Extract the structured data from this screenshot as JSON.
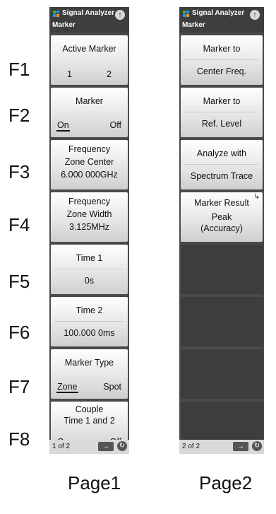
{
  "function_keys": [
    "F1",
    "F2",
    "F3",
    "F4",
    "F5",
    "F6",
    "F7",
    "F8"
  ],
  "page1": {
    "header": {
      "app_title": "Signal Analyzer",
      "menu_title": "Marker",
      "up_icon": "up-arrow-icon"
    },
    "keys": [
      {
        "title": "Active Marker",
        "options": [
          "1",
          "2"
        ],
        "selected": "1"
      },
      {
        "title": "Marker",
        "options": [
          "On",
          "Off"
        ],
        "selected": "On"
      },
      {
        "title_lines": [
          "Frequency",
          "Zone Center",
          "6.000 000GHz"
        ]
      },
      {
        "title_lines": [
          "Frequency",
          "Zone Width",
          "3.125MHz"
        ]
      },
      {
        "title": "Time 1",
        "value": "0s"
      },
      {
        "title": "Time 2",
        "value": "100.000 0ms"
      },
      {
        "title": "Marker Type",
        "options": [
          "Zone",
          "Spot"
        ],
        "selected": "Zone"
      },
      {
        "title_lines": [
          "Couple",
          "Time 1 and 2"
        ],
        "options": [
          "On",
          "Off"
        ],
        "selected": "Off"
      }
    ],
    "footer": {
      "page": "1 of 2",
      "next_icon": "right-arrow-icon",
      "rotate_icon": "rotate-icon"
    },
    "label": "Page1"
  },
  "page2": {
    "header": {
      "app_title": "Signal Analyzer",
      "menu_title": "Marker",
      "up_icon": "up-arrow-icon"
    },
    "keys": [
      {
        "title": "Marker to",
        "value": "Center Freq."
      },
      {
        "title": "Marker to",
        "value": "Ref. Level"
      },
      {
        "title": "Analyze with",
        "value": "Spectrum Trace"
      },
      {
        "title": "Marker Result",
        "value_lines": [
          "Peak",
          "(Accuracy)"
        ],
        "corner_icon": "submenu-arrow-icon"
      }
    ],
    "footer": {
      "page": "2 of 2",
      "next_icon": "right-arrow-icon",
      "rotate_icon": "rotate-icon"
    },
    "label": "Page2"
  }
}
